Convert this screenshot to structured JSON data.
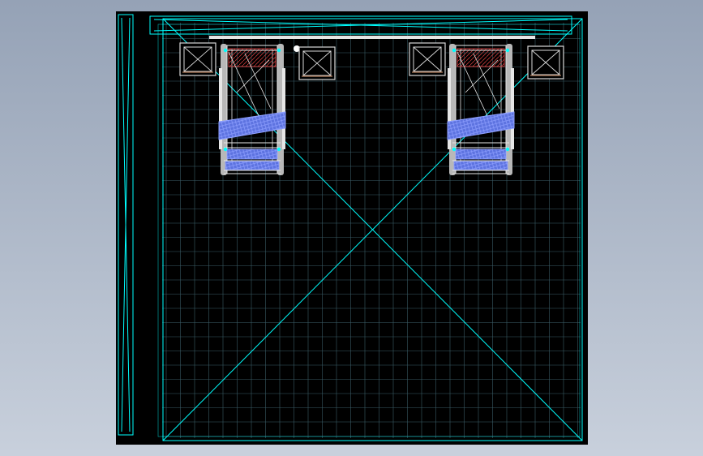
{
  "viewport": {
    "background_gradient": [
      "#95a2b6",
      "#c8d0dc"
    ],
    "drawing_background": "#000000"
  },
  "colors": {
    "frame": "#00ffff",
    "grid": "#3a5c66",
    "grid_light": "#4f7a85",
    "machine_body": "#b8b8b8",
    "machine_detail": "#e6e6e6",
    "mesh": "#5d73e0",
    "mesh_light": "#8fa0ff",
    "hatch_red": "#c23a3a",
    "hatch_brown": "#b07b5a",
    "cabinet": "#d8d8d8"
  },
  "icons": {
    "crate": "crossed-box-icon",
    "machine": "conveyor-machine-icon"
  },
  "scene": {
    "machines": [
      "machine-left",
      "machine-right"
    ],
    "crates": [
      "crate-1",
      "crate-2",
      "crate-3",
      "crate-4"
    ]
  }
}
